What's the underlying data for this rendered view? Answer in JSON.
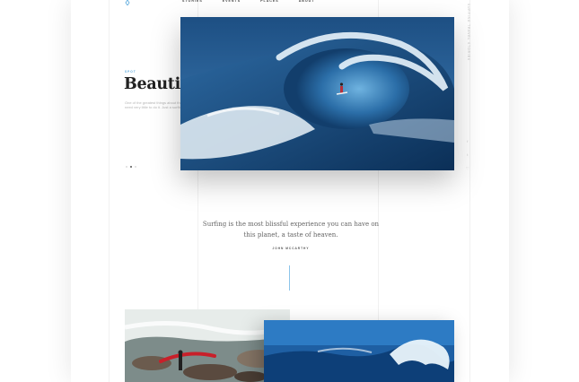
{
  "nav": {
    "items": [
      {
        "label": "STORIES"
      },
      {
        "label": "EVENTS"
      },
      {
        "label": "PLACES"
      },
      {
        "label": "ABOUT"
      }
    ]
  },
  "side": {
    "vertical_text": "SURFING TRAVEL STORIES"
  },
  "hero": {
    "kicker": "SPOT",
    "title": "Beautiful Escape",
    "description": "One of the greatest things about the sport of surfing is that you need very little to do it. Just a surfboard, and a wave."
  },
  "quote": {
    "text": "Surfing is the most blissful experience you can have on this planet, a taste of heaven.",
    "author": "JOHN MCCARTHY"
  },
  "slider": {
    "count": 3,
    "active_index": 1
  },
  "icons": {
    "logo": "surf-logo-icon",
    "social": [
      "facebook-icon",
      "twitter-icon",
      "heart-icon"
    ]
  },
  "colors": {
    "accent": "#5aa9dd",
    "wave_dark": "#0f3a66",
    "wave_light": "#3f7fb8"
  }
}
